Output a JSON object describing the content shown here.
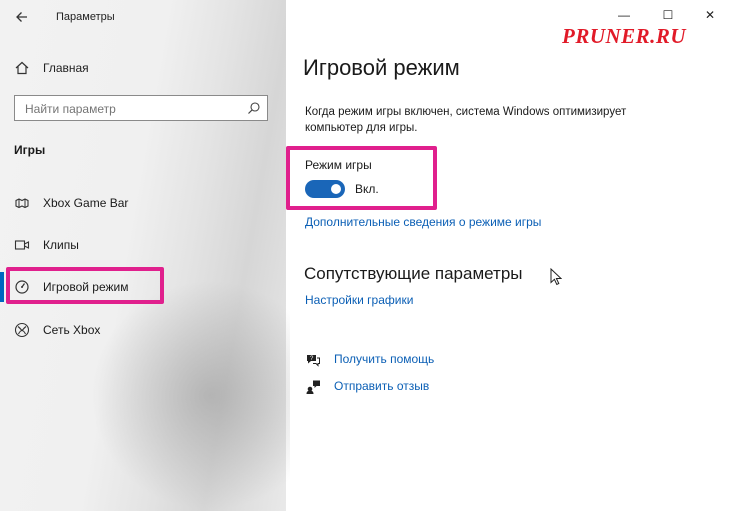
{
  "window": {
    "title": "Параметры",
    "controls": {
      "minimize": "—",
      "maximize": "☐",
      "close": "✕"
    }
  },
  "sidebar": {
    "home_label": "Главная",
    "search_placeholder": "Найти параметр",
    "section_title": "Игры",
    "items": [
      {
        "label": "Xbox Game Bar",
        "icon": "xbox-game-bar-icon"
      },
      {
        "label": "Клипы",
        "icon": "clips-icon"
      },
      {
        "label": "Игровой режим",
        "icon": "game-mode-icon",
        "active": true
      },
      {
        "label": "Сеть Xbox",
        "icon": "xbox-logo-icon"
      }
    ]
  },
  "main": {
    "title": "Игровой режим",
    "description": "Когда режим игры включен, система Windows оптимизирует компьютер для игры.",
    "toggle": {
      "label": "Режим игры",
      "state_text": "Вкл.",
      "on": true
    },
    "more_info_link": "Дополнительные сведения о режиме игры",
    "related": {
      "title": "Сопутствующие параметры",
      "graphics_link": "Настройки графики"
    },
    "help": {
      "get_help": "Получить помощь",
      "feedback": "Отправить отзыв"
    }
  },
  "watermark": "PRUNER.RU",
  "colors": {
    "accent": "#0067c0",
    "toggle_on": "#1a66b8",
    "link": "#0b5fb5",
    "highlight": "#e0208d",
    "watermark": "#e11a28"
  }
}
